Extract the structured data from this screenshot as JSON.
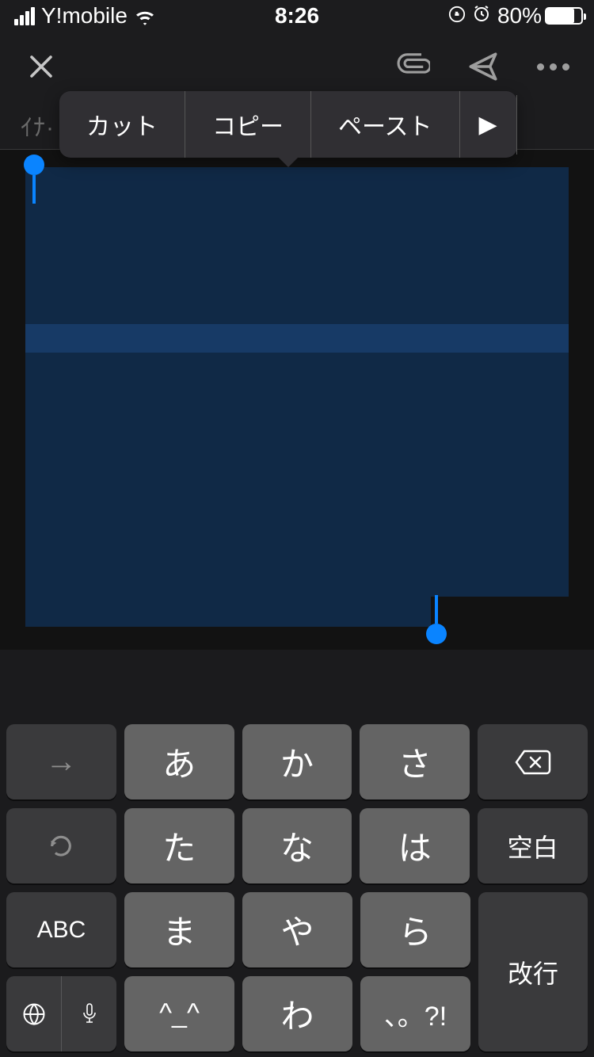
{
  "status": {
    "carrier": "Y!mobile",
    "time": "8:26",
    "battery_pct": "80%"
  },
  "toolbar": {
    "from_prefix": "ｲﾅ·"
  },
  "context_menu": {
    "cut": "カット",
    "copy": "コピー",
    "paste": "ペースト",
    "more": "▶"
  },
  "keyboard": {
    "r1": {
      "k1_arrow": "→",
      "k2": "あ",
      "k3": "か",
      "k4": "さ"
    },
    "r2": {
      "k1_undo": "↺",
      "k2": "た",
      "k3": "な",
      "k4": "は",
      "k5_space": "空白"
    },
    "r3": {
      "k1_abc": "ABC",
      "k2": "ま",
      "k3": "や",
      "k4": "ら"
    },
    "r4": {
      "k1_globe": "🌐",
      "k1_mic": "🎤",
      "k2": "^_^",
      "k3": "わ",
      "k4": "、。?!",
      "return": "改行"
    }
  }
}
